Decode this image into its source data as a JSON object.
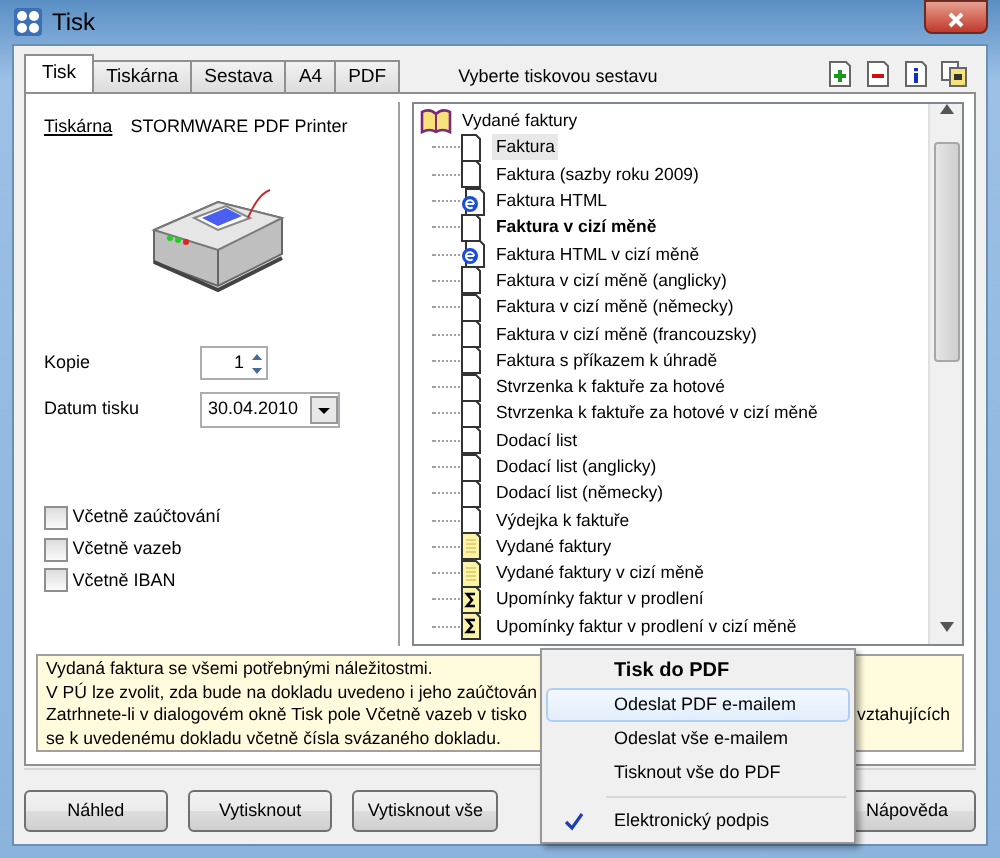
{
  "window": {
    "title": "Tisk"
  },
  "tabs": [
    {
      "label": "Tisk",
      "selected": true
    },
    {
      "label": "Tiskárna",
      "selected": false
    },
    {
      "label": "Sestava",
      "selected": false
    },
    {
      "label": "A4",
      "selected": false
    },
    {
      "label": "PDF",
      "selected": false
    }
  ],
  "tree_caption": "Vyberte tiskovou sestavu",
  "toolbar": [
    {
      "kind": "add"
    },
    {
      "kind": "remove"
    },
    {
      "kind": "info"
    },
    {
      "kind": "copy"
    }
  ],
  "printer": {
    "link": "Tiskárna",
    "name": "STORMWARE PDF Printer"
  },
  "copies": {
    "label": "Kopie",
    "value": "1"
  },
  "print_date": {
    "label": "Datum tisku",
    "value": "30.04.2010"
  },
  "options": [
    {
      "label": "Včetně zaúčtování",
      "checked": false
    },
    {
      "label": "Včetně vazeb",
      "checked": false
    },
    {
      "label": "Včetně IBAN",
      "checked": false
    }
  ],
  "tree": {
    "label": "Vydané faktury",
    "expanded": true,
    "children": [
      {
        "label": "Faktura",
        "kind": "doc",
        "selected": true,
        "default": false
      },
      {
        "label": "Faktura (sazby roku 2009)",
        "kind": "doc",
        "selected": false,
        "default": false
      },
      {
        "label": "Faktura HTML",
        "kind": "html",
        "selected": false,
        "default": false
      },
      {
        "label": "Faktura v cizí měně",
        "kind": "doc",
        "selected": false,
        "default": true
      },
      {
        "label": "Faktura HTML v cizí měně",
        "kind": "html",
        "selected": false,
        "default": false
      },
      {
        "label": "Faktura v cizí měně (anglicky)",
        "kind": "doc",
        "selected": false,
        "default": false
      },
      {
        "label": "Faktura v cizí měně (německy)",
        "kind": "doc",
        "selected": false,
        "default": false
      },
      {
        "label": "Faktura v cizí měně (francouzsky)",
        "kind": "doc",
        "selected": false,
        "default": false
      },
      {
        "label": "Faktura s příkazem k úhradě",
        "kind": "doc",
        "selected": false,
        "default": false
      },
      {
        "label": "Stvrzenka k faktuře za hotové",
        "kind": "doc",
        "selected": false,
        "default": false
      },
      {
        "label": "Stvrzenka k faktuře za hotové v cizí měně",
        "kind": "doc",
        "selected": false,
        "default": false
      },
      {
        "label": "Dodací list",
        "kind": "doc",
        "selected": false,
        "default": false
      },
      {
        "label": "Dodací list (anglicky)",
        "kind": "doc",
        "selected": false,
        "default": false
      },
      {
        "label": "Dodací list (německy)",
        "kind": "doc",
        "selected": false,
        "default": false
      },
      {
        "label": "Výdejka k faktuře",
        "kind": "doc",
        "selected": false,
        "default": false
      },
      {
        "label": "Vydané faktury",
        "kind": "list",
        "selected": false,
        "default": false
      },
      {
        "label": "Vydané faktury v cizí měně",
        "kind": "list",
        "selected": false,
        "default": false
      },
      {
        "label": "Upomínky faktur v prodlení",
        "kind": "sum",
        "selected": false,
        "default": false
      },
      {
        "label": "Upomínky faktur v prodlení v cizí měně",
        "kind": "sum",
        "selected": false,
        "default": false
      }
    ]
  },
  "description": [
    {
      "left": "Vydaná faktura se všemi potřebnými náležitostmi."
    },
    {
      "left": "V PÚ lze zvolit, zda bude na dokladu uvedeno i jeho zaúčtován"
    },
    {
      "left": "Zatrhnete-li v dialogovém okně Tisk pole Včetně vazeb v tisko",
      "right": "vztahujících"
    },
    {
      "left": "se k uvedenému dokladu včetně čísla svázaného dokladu."
    }
  ],
  "buttons": [
    {
      "label": "Náhled"
    },
    {
      "label": "Vytisknout"
    },
    {
      "label": "Vytisknout vše"
    },
    {
      "label": "Nápověda"
    }
  ],
  "menu": [
    {
      "kind": "item",
      "label": "Tisk do PDF",
      "default": true,
      "selected": false,
      "checked": false
    },
    {
      "kind": "item",
      "label": "Odeslat PDF e-mailem",
      "default": false,
      "selected": true,
      "checked": false
    },
    {
      "kind": "item",
      "label": "Odeslat vše e-mailem",
      "default": false,
      "selected": false,
      "checked": false
    },
    {
      "kind": "item",
      "label": "Tisknout vše do PDF",
      "default": false,
      "selected": false,
      "checked": false
    },
    {
      "kind": "separator"
    },
    {
      "kind": "item",
      "label": "Elektronický podpis",
      "default": false,
      "selected": false,
      "checked": true
    }
  ]
}
